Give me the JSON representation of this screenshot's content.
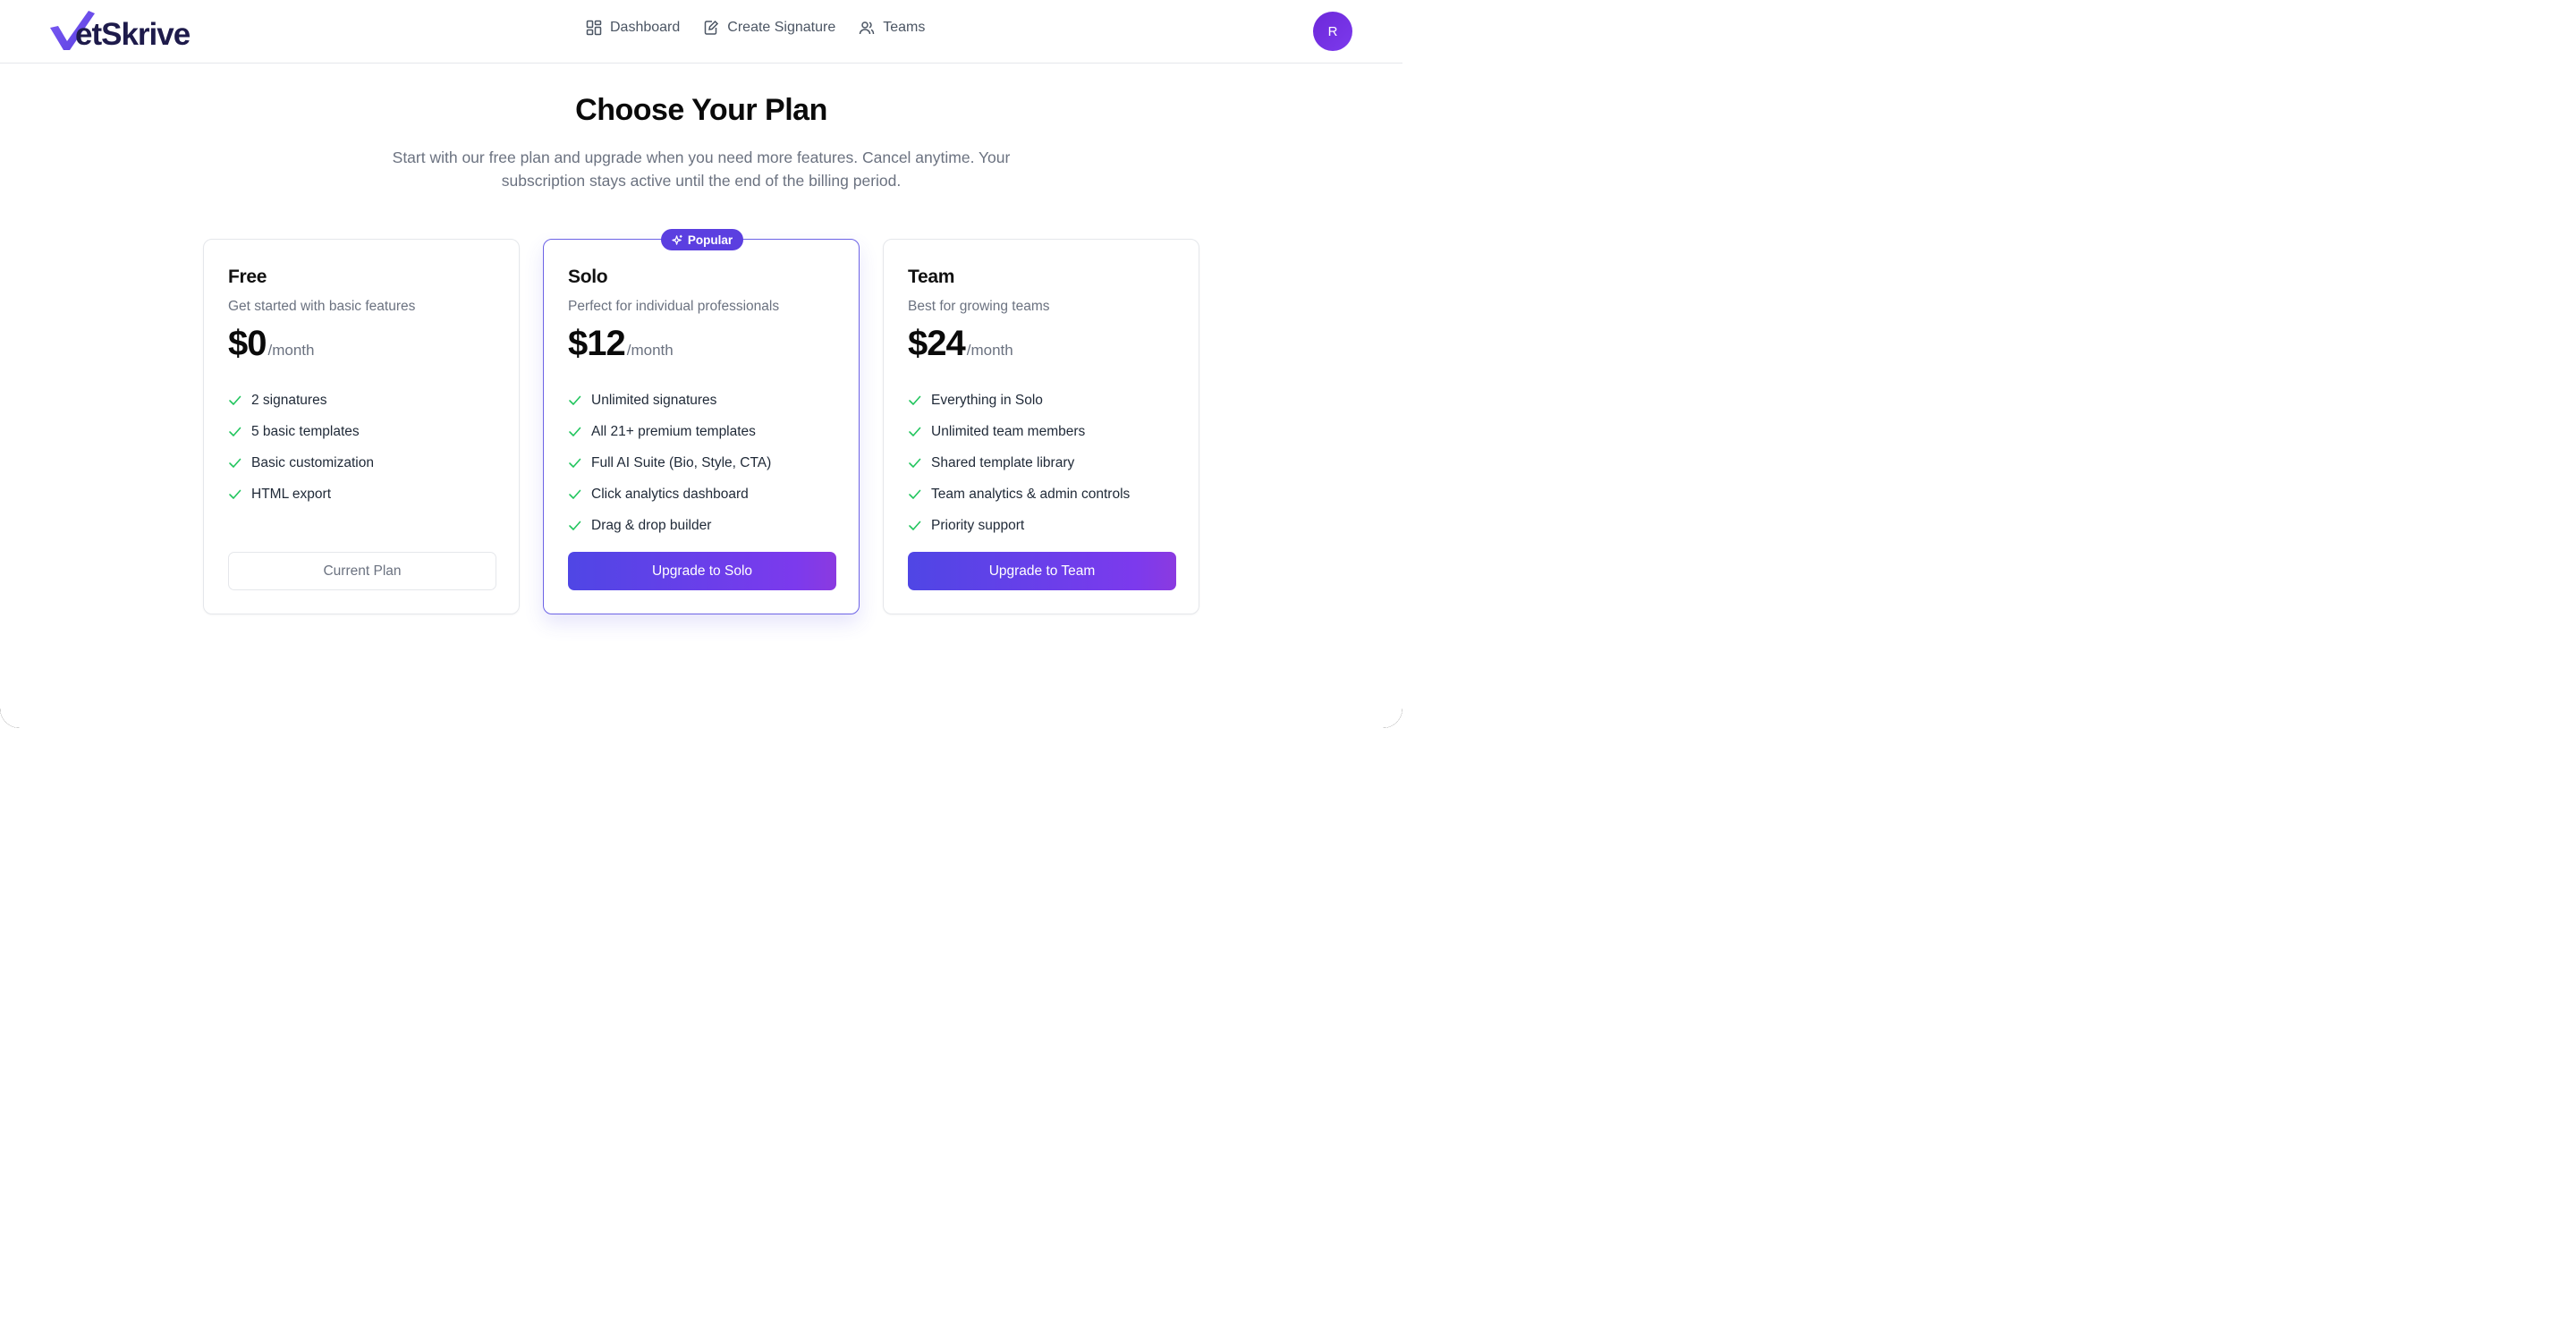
{
  "brand": {
    "name": "etSkrive",
    "accent": "#5b3fe0"
  },
  "nav": {
    "items": [
      {
        "label": "Dashboard",
        "icon": "layout-grid-icon"
      },
      {
        "label": "Create Signature",
        "icon": "edit-file-icon"
      },
      {
        "label": "Teams",
        "icon": "users-icon"
      }
    ]
  },
  "user": {
    "avatar_initial": "R"
  },
  "hero": {
    "title": "Choose Your Plan",
    "subtitle": "Start with our free plan and upgrade when you need more features. Cancel anytime. Your subscription stays active until the end of the billing period."
  },
  "plans": [
    {
      "name": "Free",
      "description": "Get started with basic features",
      "price": "$0",
      "period": "/month",
      "features": [
        "2 signatures",
        "5 basic templates",
        "Basic customization",
        "HTML export"
      ],
      "button": "Current Plan"
    },
    {
      "name": "Solo",
      "badge": "Popular",
      "description": "Perfect for individual professionals",
      "price": "$12",
      "period": "/month",
      "features": [
        "Unlimited signatures",
        "All 21+ premium templates",
        "Full AI Suite (Bio, Style, CTA)",
        "Click analytics dashboard",
        "Drag & drop builder"
      ],
      "button": "Upgrade to Solo"
    },
    {
      "name": "Team",
      "description": "Best for growing teams",
      "price": "$24",
      "period": "/month",
      "features": [
        "Everything in Solo",
        "Unlimited team members",
        "Shared template library",
        "Team analytics & admin controls",
        "Priority support"
      ],
      "button": "Upgrade to Team"
    }
  ],
  "colors": {
    "check": "#22c55e",
    "button_gradient_start": "#4f46e5",
    "button_gradient_end": "#7c3aed"
  }
}
